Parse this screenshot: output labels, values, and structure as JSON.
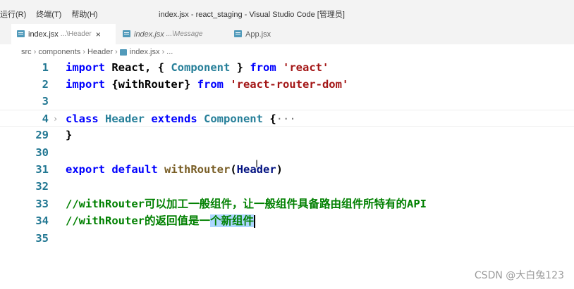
{
  "menu": {
    "run": "运行(R)",
    "terminal": "终端(T)",
    "help": "帮助(H)"
  },
  "window_title": "index.jsx - react_staging - Visual Studio Code [管理员]",
  "tabs": [
    {
      "name": "index.jsx",
      "desc": "...\\Header",
      "close": "×",
      "active": true
    },
    {
      "name": "index.jsx",
      "desc": "...\\Message",
      "active": false
    },
    {
      "name": "App.jsx",
      "active": false
    }
  ],
  "breadcrumb": {
    "p1": "src",
    "p2": "components",
    "p3": "Header",
    "p4": "index.jsx",
    "p5": "..."
  },
  "lines": {
    "l1": {
      "num": "1",
      "kw": "import",
      "t1": " React, { ",
      "cls": "Component",
      "t2": " } ",
      "kw2": "from",
      "str": " 'react'"
    },
    "l2": {
      "num": "2",
      "kw": "import",
      "t1": " {withRouter} ",
      "kw2": "from",
      "str": " 'react-router-dom'"
    },
    "l3": {
      "num": "3"
    },
    "l4": {
      "num": "4",
      "fold": "›",
      "kw": "class",
      "cls": " Header",
      "kw2": " extends",
      "cls2": " Component",
      "t1": " {",
      "ellip": "···"
    },
    "l29": {
      "num": "29",
      "t1": "}"
    },
    "l30": {
      "num": "30"
    },
    "l31": {
      "num": "31",
      "kw": "export",
      "kw2": " default",
      "fn": " withRouter",
      "t1": "(",
      "var": "Header",
      "t2": ")"
    },
    "l32": {
      "num": "32"
    },
    "l33": {
      "num": "33",
      "cmt": "//withRouter可以加工一般组件，让一般组件具备路由组件所特有的API"
    },
    "l34": {
      "num": "34",
      "cmt": "//withRouter的返回值是一",
      "sel": "个新组件"
    },
    "l35": {
      "num": "35"
    }
  },
  "watermark": "CSDN @大白兔123"
}
